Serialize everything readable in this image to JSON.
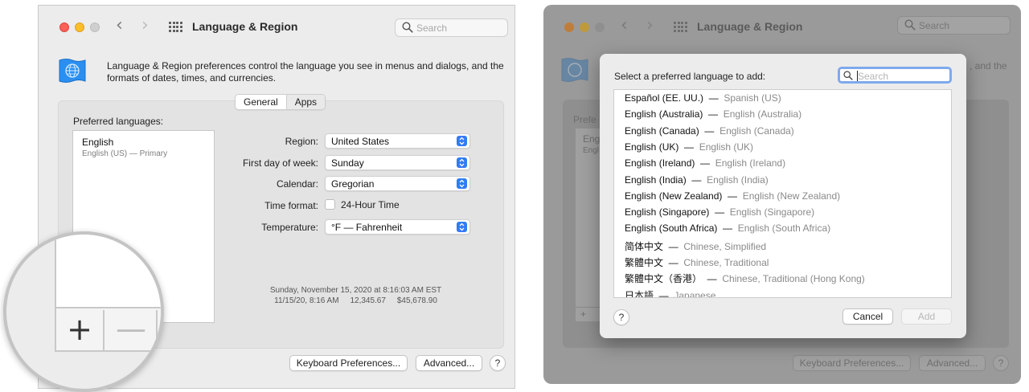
{
  "left": {
    "title": "Language & Region",
    "search_placeholder": "Search",
    "description": "Language & Region preferences control the language you see in menus and dialogs, and the formats of dates, times, and currencies.",
    "tabs": [
      "General",
      "Apps"
    ],
    "preferred_label": "Preferred languages:",
    "language": {
      "name": "English",
      "detail": "English (US) — Primary"
    },
    "region_label": "Region:",
    "region_value": "United States",
    "week_label": "First day of week:",
    "week_value": "Sunday",
    "calendar_label": "Calendar:",
    "calendar_value": "Gregorian",
    "time_label": "Time format:",
    "time_option": "24-Hour Time",
    "temp_label": "Temperature:",
    "temp_value": "°F — Fahrenheit",
    "sample_line1": "Sunday, November 15, 2020 at 8:16:03 AM EST",
    "sample_line2": "11/15/20, 8:16 AM     12,345.67     $45,678.90",
    "keyboard_button": "Keyboard Preferences...",
    "advanced_button": "Advanced...",
    "help": "?",
    "plus": "+",
    "minus": "—"
  },
  "right": {
    "title": "Language & Region",
    "search_placeholder": "Search",
    "bg_desc_tail": ", and the",
    "bg_pref": "Prefe",
    "bg_eng": "Eng",
    "bg_eng2": "Engl",
    "bg_keyboard": "Keyboard Preferences...",
    "bg_advanced": "Advanced...",
    "bg_help": "?",
    "bg_plus": "+",
    "sheet": {
      "prompt": "Select a preferred language to add:",
      "search_placeholder": "Search",
      "languages": [
        {
          "native": "Español (EE. UU.)",
          "english": "Spanish (US)"
        },
        {
          "native": "English (Australia)",
          "english": "English (Australia)"
        },
        {
          "native": "English (Canada)",
          "english": "English (Canada)"
        },
        {
          "native": "English (UK)",
          "english": "English (UK)"
        },
        {
          "native": "English (Ireland)",
          "english": "English (Ireland)"
        },
        {
          "native": "English (India)",
          "english": "English (India)"
        },
        {
          "native": "English (New Zealand)",
          "english": "English (New Zealand)"
        },
        {
          "native": "English (Singapore)",
          "english": "English (Singapore)"
        },
        {
          "native": "English (South Africa)",
          "english": "English (South Africa)"
        },
        {
          "native": "简体中文",
          "english": "Chinese, Simplified"
        },
        {
          "native": "繁體中文",
          "english": "Chinese, Traditional"
        },
        {
          "native": "繁體中文（香港）",
          "english": "Chinese, Traditional (Hong Kong)"
        },
        {
          "native": "日本語",
          "english": "Japanese"
        }
      ],
      "separator": "—",
      "help": "?",
      "cancel_button": "Cancel",
      "add_button": "Add"
    }
  },
  "colors": {
    "accent": "#2f7cf6",
    "close": "#fe5f57",
    "minimize": "#febc2e",
    "inactive": "#cfcfcf"
  }
}
